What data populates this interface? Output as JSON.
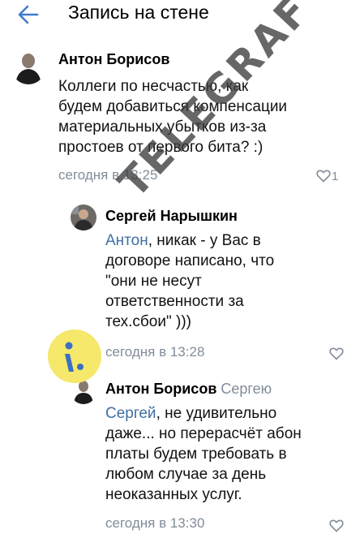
{
  "header": {
    "title": "Запись на стене",
    "back_icon": "arrow-left-icon"
  },
  "comments": [
    {
      "author": "Антон Борисов",
      "reply_to": "",
      "mention": "",
      "lines": [
        "Коллеги по несчастью, как",
        "будем добавиться компенсации",
        "материальных убытков из-за",
        "простоев от первого бита? :)"
      ],
      "date": "сегодня в 13:25",
      "likes": "1"
    },
    {
      "author": "Сергей Нарышкин",
      "reply_to": "",
      "mention": "Антон",
      "first_rest": ", никак - у Вас в",
      "lines": [
        "договоре написано, что",
        "\"они не несут",
        "ответственности за",
        "тех.сбои\" )))"
      ],
      "date": "сегодня в 13:28",
      "likes": ""
    },
    {
      "author": "Антон Борисов",
      "reply_to": "Сергею",
      "mention": "Сергей",
      "first_rest": ", не удивительно",
      "lines": [
        "даже... но перерасчёт абон",
        "платы будем требовать в",
        "любом случае за день",
        "неоказанных услуг."
      ],
      "date": "сегодня в 13:30",
      "likes": ""
    }
  ],
  "watermark": "TELEGRAF",
  "colors": {
    "meta": "#818c99",
    "mention": "#3f6fa3",
    "logo": "#f5e86a"
  }
}
